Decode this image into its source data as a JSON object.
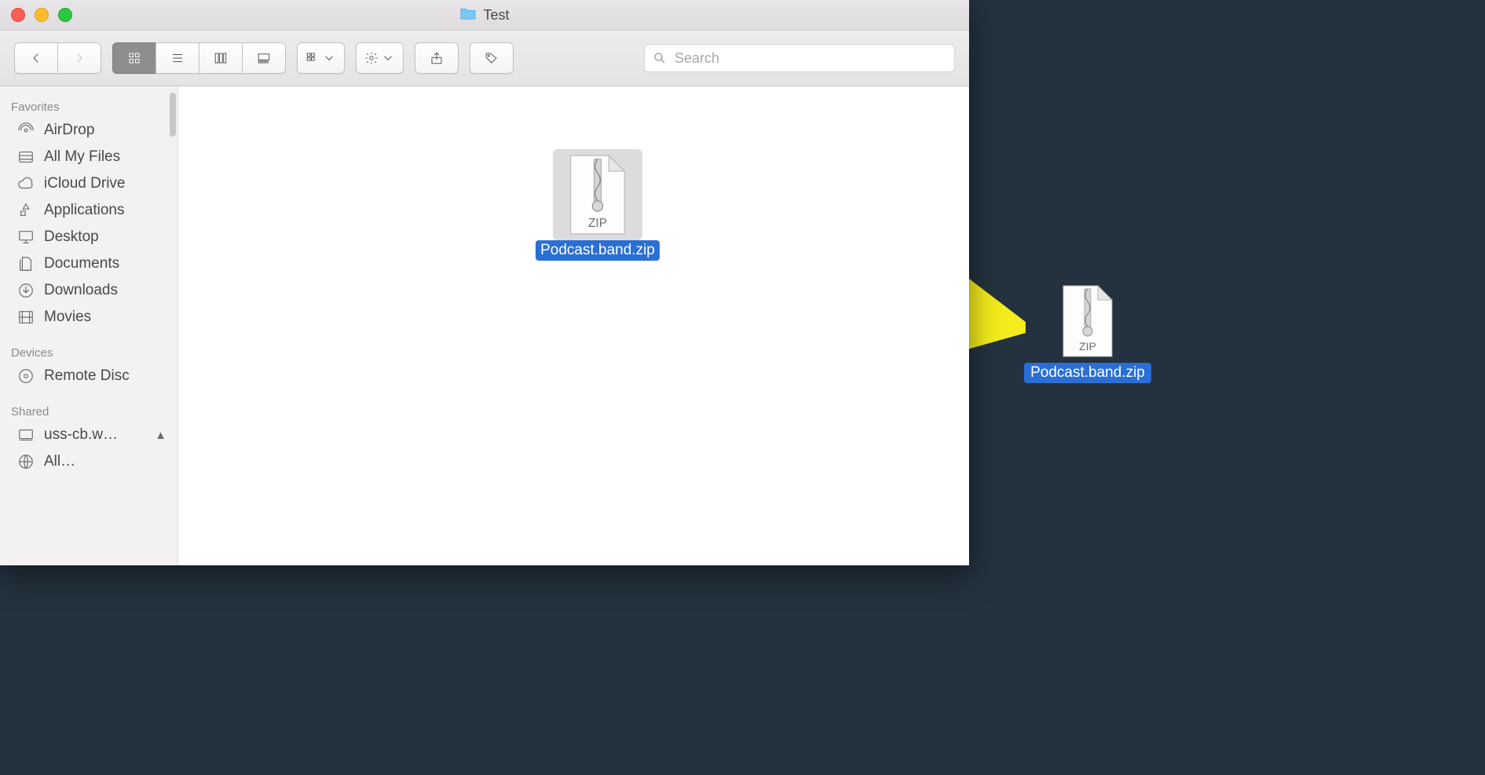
{
  "window": {
    "title": "Test"
  },
  "search": {
    "placeholder": "Search"
  },
  "sidebar": {
    "sections": [
      {
        "title": "Favorites",
        "items": [
          {
            "label": "AirDrop"
          },
          {
            "label": "All My Files"
          },
          {
            "label": "iCloud Drive"
          },
          {
            "label": "Applications"
          },
          {
            "label": "Desktop"
          },
          {
            "label": "Documents"
          },
          {
            "label": "Downloads"
          },
          {
            "label": "Movies"
          }
        ]
      },
      {
        "title": "Devices",
        "items": [
          {
            "label": "Remote Disc"
          }
        ]
      },
      {
        "title": "Shared",
        "items": [
          {
            "label": "uss-cb.w…",
            "eject": true
          },
          {
            "label": "All…"
          }
        ]
      }
    ]
  },
  "content": {
    "files": [
      {
        "name": "Podcast.band.zip",
        "type": "ZIP",
        "selected": true
      }
    ]
  },
  "desktop_file": {
    "name": "Podcast.band.zip",
    "type": "ZIP",
    "selected": true
  },
  "annotation": {
    "arrow_color": "#f4ec1c"
  }
}
